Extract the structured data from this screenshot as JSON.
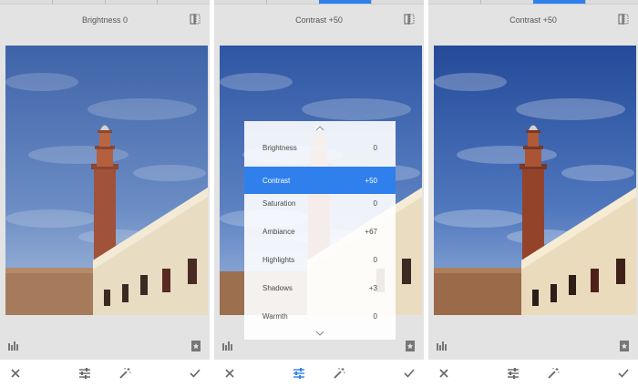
{
  "panels": [
    {
      "header": "Brightness 0",
      "slider_fill": 0.0,
      "tool_active": false,
      "menu_open": false
    },
    {
      "header": "Contrast +50",
      "slider_fill": 0.75,
      "tool_active": true,
      "menu_open": true
    },
    {
      "header": "Contrast +50",
      "slider_fill": 0.75,
      "tool_active": false,
      "menu_open": false
    }
  ],
  "adjust_menu": {
    "items": [
      {
        "label": "Brightness",
        "value": "0",
        "selected": false
      },
      {
        "label": "Contrast",
        "value": "+50",
        "selected": true
      },
      {
        "label": "Saturation",
        "value": "0",
        "selected": false
      },
      {
        "label": "Ambiance",
        "value": "+67",
        "selected": false
      },
      {
        "label": "Highlights",
        "value": "0",
        "selected": false
      },
      {
        "label": "Shadows",
        "value": "+3",
        "selected": false
      },
      {
        "label": "Warmth",
        "value": "0",
        "selected": false
      }
    ]
  },
  "icons": {
    "compare": "compare-icon",
    "histogram": "histogram-icon",
    "bookmark": "bookmark-icon",
    "cancel": "close-icon",
    "tune": "tune-sliders-icon",
    "wand": "magic-wand-icon",
    "apply": "checkmark-icon"
  },
  "colors": {
    "accent": "#2f80ed",
    "icon_gray": "#777777",
    "panel_bg": "#e3e3e3"
  }
}
